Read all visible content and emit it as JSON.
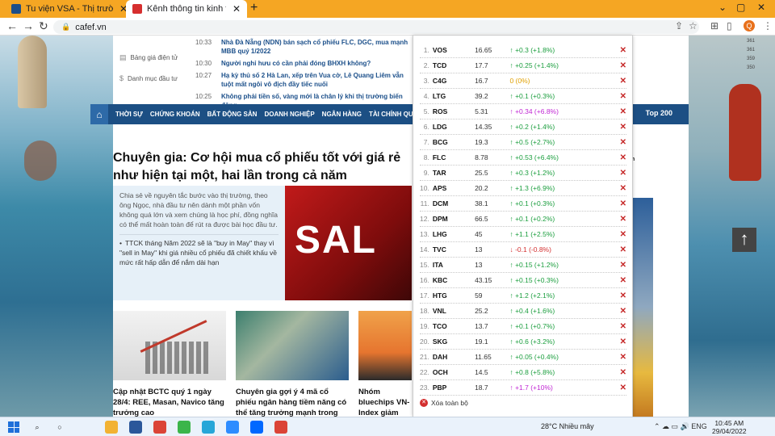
{
  "tabs": [
    {
      "label": "Tu viện VSA - Thị trường chứng k",
      "favicon": "vsa-favicon-icon",
      "color": "#1d4e89"
    },
    {
      "label": "Kênh thông tin kinh tế - tài chính",
      "favicon": "cafef-favicon-icon",
      "color": "#d62f2f"
    }
  ],
  "address": {
    "url": "cafef.vn"
  },
  "profile_initial": "Q",
  "sidebar": {
    "items": [
      {
        "label": "Bảng giá điện tử",
        "icon": "chart-icon"
      },
      {
        "label": "Danh mục đầu tư",
        "icon": "dollar-icon"
      }
    ]
  },
  "news": [
    {
      "time": "10:33",
      "title": "Nhà Đà Nẵng (NDN) bán sạch cổ phiếu FLC, DGC, mua mạnh MBB quý 1/2022"
    },
    {
      "time": "10:30",
      "title": "Người nghỉ hưu có cần phải đóng BHXH không?"
    },
    {
      "time": "10:27",
      "title": "Hạ kỳ thủ số 2 Hà Lan, xếp trên Vua cờ, Lê Quang Liêm vẫn tuột mất ngôi vô địch đầy tiếc nuối"
    },
    {
      "time": "10:25",
      "title": "Không phải tiền số, vàng mới là chân lý khi thị trường biến động"
    }
  ],
  "nav": {
    "items": [
      "THỜI SỰ",
      "CHỨNG KHOÁN",
      "BẤT ĐỘNG SẢN",
      "DOANH NGHIỆP",
      "NGÂN HÀNG",
      "TÀI CHÍNH QUỐC TẾ",
      "VĨ"
    ],
    "right_partial": "ệu",
    "right": "Top 200"
  },
  "article": {
    "headline": "Chuyên gia: Cơ hội mua cổ phiếu tốt với giá rẻ như hiện tại một, hai lần trong cả năm",
    "lead": "Chia sẻ về nguyên tắc bước vào thị trường, theo ông Ngọc, nhà đầu tư nên dành một phần vốn không quá lớn và xem chúng là học phí, đồng nghĩa có thể mất hoàn toàn để rút ra được bài học đầu tư.",
    "related": "TTCK tháng Năm 2022 sẽ là \"buy in May\" thay vì \"sell in May\" khi giá nhiều cổ phiếu đã chiết khấu về mức rất hấp dẫn để nắm dài hạn",
    "image_text": "SAL"
  },
  "thumbs": [
    {
      "title": "Cập nhật BCTC quý 1 ngày 28/4: REE, Masan, Navico tăng trưởng cao"
    },
    {
      "title": "Chuyên gia gợi ý 4 mã cổ phiếu ngân hàng tiềm năng có thể tăng trưởng mạnh trong thời gian tới"
    },
    {
      "title": "Nhóm bluechips VN-Index giảm phiếu cổ phiếu"
    }
  ],
  "side_ad": {
    "chip": "m",
    "numbers": [
      "361",
      "361",
      "359",
      "350"
    ]
  },
  "stocks": [
    {
      "idx": "1.",
      "sym": "VOS",
      "price": "16.65",
      "dir": "up",
      "chg": "↑ +0.3 (+1.8%)"
    },
    {
      "idx": "2.",
      "sym": "TCD",
      "price": "17.7",
      "dir": "up",
      "chg": "↑ +0.25 (+1.4%)"
    },
    {
      "idx": "3.",
      "sym": "C4G",
      "price": "16.7",
      "dir": "flat",
      "chg": "0 (0%)"
    },
    {
      "idx": "4.",
      "sym": "LTG",
      "price": "39.2",
      "dir": "up",
      "chg": "↑ +0.1 (+0.3%)"
    },
    {
      "idx": "5.",
      "sym": "ROS",
      "price": "5.31",
      "dir": "ceil",
      "chg": "↑ +0.34 (+6.8%)"
    },
    {
      "idx": "6.",
      "sym": "LDG",
      "price": "14.35",
      "dir": "up",
      "chg": "↑ +0.2 (+1.4%)"
    },
    {
      "idx": "7.",
      "sym": "BCG",
      "price": "19.3",
      "dir": "up",
      "chg": "↑ +0.5 (+2.7%)"
    },
    {
      "idx": "8.",
      "sym": "FLC",
      "price": "8.78",
      "dir": "up",
      "chg": "↑ +0.53 (+6.4%)"
    },
    {
      "idx": "9.",
      "sym": "TAR",
      "price": "25.5",
      "dir": "up",
      "chg": "↑ +0.3 (+1.2%)"
    },
    {
      "idx": "10.",
      "sym": "APS",
      "price": "20.2",
      "dir": "up",
      "chg": "↑ +1.3 (+6.9%)"
    },
    {
      "idx": "11.",
      "sym": "DCM",
      "price": "38.1",
      "dir": "up",
      "chg": "↑ +0.1 (+0.3%)"
    },
    {
      "idx": "12.",
      "sym": "DPM",
      "price": "66.5",
      "dir": "up",
      "chg": "↑ +0.1 (+0.2%)"
    },
    {
      "idx": "13.",
      "sym": "LHG",
      "price": "45",
      "dir": "up",
      "chg": "↑ +1.1 (+2.5%)"
    },
    {
      "idx": "14.",
      "sym": "TVC",
      "price": "13",
      "dir": "down",
      "chg": "↓ -0.1 (-0.8%)"
    },
    {
      "idx": "15.",
      "sym": "ITA",
      "price": "13",
      "dir": "up",
      "chg": "↑ +0.15 (+1.2%)"
    },
    {
      "idx": "16.",
      "sym": "KBC",
      "price": "43.15",
      "dir": "up",
      "chg": "↑ +0.15 (+0.3%)"
    },
    {
      "idx": "17.",
      "sym": "HTG",
      "price": "59",
      "dir": "up",
      "chg": "↑ +1.2 (+2.1%)"
    },
    {
      "idx": "18.",
      "sym": "VNL",
      "price": "25.2",
      "dir": "up",
      "chg": "↑ +0.4 (+1.6%)"
    },
    {
      "idx": "19.",
      "sym": "TCO",
      "price": "13.7",
      "dir": "up",
      "chg": "↑ +0.1 (+0.7%)"
    },
    {
      "idx": "20.",
      "sym": "SKG",
      "price": "19.1",
      "dir": "up",
      "chg": "↑ +0.6 (+3.2%)"
    },
    {
      "idx": "21.",
      "sym": "DAH",
      "price": "11.65",
      "dir": "up",
      "chg": "↑ +0.05 (+0.4%)"
    },
    {
      "idx": "22.",
      "sym": "OCH",
      "price": "14.5",
      "dir": "up",
      "chg": "↑ +0.8 (+5.8%)"
    },
    {
      "idx": "23.",
      "sym": "PBP",
      "price": "18.7",
      "dir": "ceil",
      "chg": "↑ +1.7 (+10%)"
    }
  ],
  "clear_all": "Xóa toàn bộ",
  "taskbar": {
    "weather": "28°C  Nhiều mây",
    "time": "10:45 AM",
    "date": "29/04/2022",
    "apps": [
      {
        "name": "explorer-icon",
        "color": "#f2b233"
      },
      {
        "name": "word-icon",
        "color": "#2b579a"
      },
      {
        "name": "chrome-icon",
        "color": "#db4437"
      },
      {
        "name": "app-icon",
        "color": "#3bb54a"
      },
      {
        "name": "webex-icon",
        "color": "#27a6d8"
      },
      {
        "name": "zoom-icon",
        "color": "#2d8cff"
      },
      {
        "name": "zalo-icon",
        "color": "#0068ff"
      },
      {
        "name": "chrome-icon",
        "color": "#db4437"
      }
    ]
  },
  "colors": {
    "accent_nav": "#1c4f84",
    "tab_bar": "#f5a623",
    "up": "#1b9e3e",
    "down": "#d32f2f",
    "ceiling": "#c026d3"
  }
}
